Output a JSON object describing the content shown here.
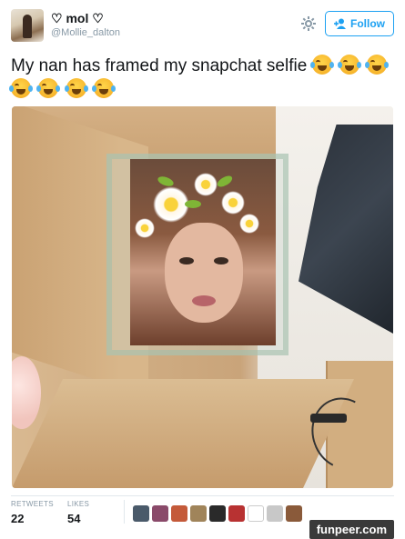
{
  "tweet": {
    "display_name": "♡ mol ♡",
    "handle": "@Mollie_dalton",
    "follow_label": "Follow",
    "text": "My nan has framed my snapchat selfie",
    "emoji_count": 7,
    "emoji_name": "face-with-tears-of-joy"
  },
  "stats": {
    "retweets_label": "RETWEETS",
    "retweets_value": "22",
    "likes_label": "LIKES",
    "likes_value": "54"
  },
  "likers": [
    "#4a5a6a",
    "#8a4a6a",
    "#c45a3a",
    "#a0845a",
    "#2a2a2a",
    "#b83232",
    "#ffffff",
    "#c8c8c8",
    "#8a5a3a"
  ],
  "watermark": "funpeer.com",
  "colors": {
    "accent": "#1da1f2",
    "muted": "#8899a6",
    "text": "#14171a"
  }
}
